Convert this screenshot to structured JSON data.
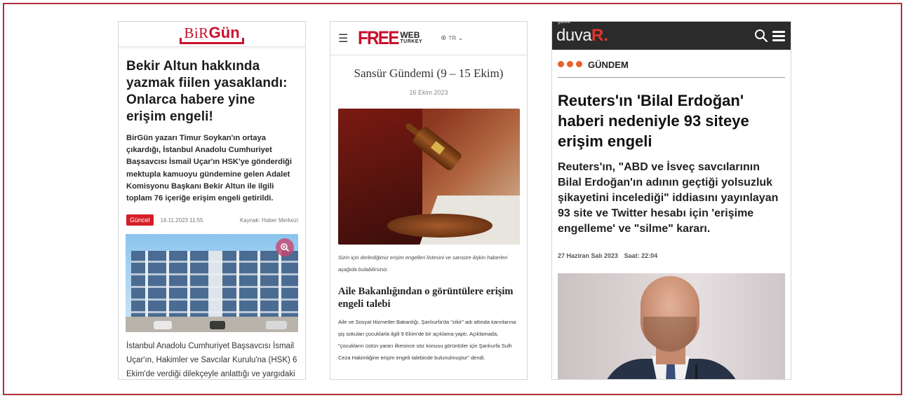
{
  "birgun": {
    "logo_bir": "BiR",
    "logo_gun": "Gün",
    "headline": "Bekir Altun hakkında yazmak fiilen yasaklandı: Onlarca habere yine erişim engeli!",
    "lead": "BirGün yazarı Timur Soykan'ın ortaya çıkardığı, İstanbul Anadolu Cumhuriyet Başsavcısı İsmail Uçar'ın HSK'ye gönderdiği mektupla kamuoyu gündemine gelen Adalet Komisyonu Başkanı Bekir Altun ile ilgili toplam 76 içeriğe erişim engeli getirildi.",
    "tag": "Güncel",
    "date": "16.11.2023 11:55",
    "source": "Kaynak: Haber Merkezi",
    "body": "İstanbul Anadolu Cumhuriyet Başsavcısı İsmail Uçar'ın, Hakimler ve Savcılar Kurulu'na (HSK) 6 Ekim'de verdiği dilekçeyle anlattığı ve yargıdaki"
  },
  "freeweb": {
    "logo_free": "FREE",
    "logo_web": "WEB",
    "logo_turkey": "TURKEY",
    "lang": "TR",
    "title": "Sansür Gündemi (9 – 15 Ekim)",
    "date": "16 Ekim 2023",
    "caption": "Sizin için derlediğimiz erişim engelleri listesini ve sansüre ilişkin haberleri aşağıda bulabilirsiniz.",
    "subhead": "Aile Bakanlığından o görüntülere erişim engeli talebi",
    "body": "Aile ve Sosyal Hizmetler Bakanlığı, Şanlıurfa'da \"zikir\" adı altında karınlarına şiş sokulan çocuklarla ilgili 9 Ekim'de bir açıklama yaptı. Açıklamada, \"çocukların üstün yararı ilkesince söz konusu görüntüler için Şanlıurfa Sulh Ceza Hakimliğine erişim engeli talebinde bulunulmuştur\" dendi."
  },
  "duvar": {
    "logo_gazete": "gazete",
    "logo_duva": "duva",
    "logo_r": "R",
    "logo_dot": ".",
    "category": "GÜNDEM",
    "headline": "Reuters'ın 'Bilal Erdoğan' haberi nedeniyle 93 siteye erişim engeli",
    "lead": "Reuters'ın, \"ABD ve İsveç savcılarının Bilal Erdoğan'ın adının geçtiği yolsuzluk şikayetini incelediği\" iddiasını yayınlayan 93 site ve Twitter hesabı için 'erişime engelleme' ve \"silme\" kararı.",
    "date": "27 Haziran Salı 2023",
    "time": "Saat: 22:04"
  },
  "colors": {
    "frame": "#b0303b",
    "birgun_red": "#c8102e",
    "duvar_header": "#2b2b2b",
    "duvar_accent": "#e0342c",
    "duvar_dots": "#e8622a"
  },
  "icons": {
    "birgun_photo_zoom": "zoom-in-icon",
    "freeweb_menu": "hamburger-menu-icon",
    "freeweb_lang": "globe-icon",
    "duvar_search": "search-icon",
    "duvar_menu": "hamburger-menu-icon"
  }
}
